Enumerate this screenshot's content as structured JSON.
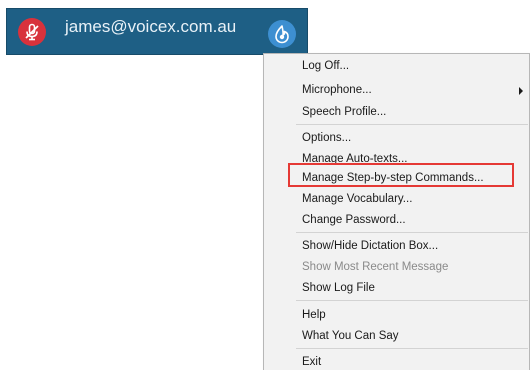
{
  "toolbar": {
    "user": "james@voicex.com.au",
    "colors": {
      "bar": "#1e5f85",
      "mic": "#d8323c",
      "logo": "#3d8fd1"
    },
    "icons": {
      "mic": "microphone-off-icon",
      "logo": "voicex-logo-icon"
    }
  },
  "menu": {
    "items": [
      {
        "label": "Log Off..."
      },
      {
        "label": "Microphone...",
        "submenu": true
      },
      {
        "label": "Speech Profile..."
      },
      {
        "label": "Options..."
      },
      {
        "label": "Manage Auto-texts..."
      },
      {
        "label": "Manage Step-by-step Commands...",
        "highlighted": true
      },
      {
        "label": "Manage Vocabulary..."
      },
      {
        "label": "Change Password..."
      },
      {
        "label": "Show/Hide Dictation Box..."
      },
      {
        "label": "Show Most Recent Message",
        "disabled": true
      },
      {
        "label": "Show Log File"
      },
      {
        "label": "Help"
      },
      {
        "label": "What You Can Say"
      },
      {
        "label": "Exit"
      }
    ],
    "highlight_color": "#e53935"
  }
}
